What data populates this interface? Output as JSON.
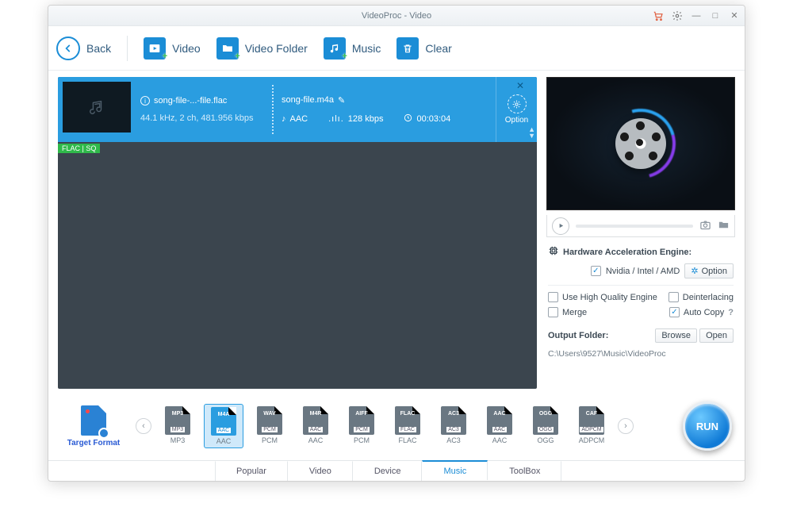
{
  "title": "VideoProc - Video",
  "toolbar": {
    "back": "Back",
    "video": "Video",
    "video_folder": "Video Folder",
    "music": "Music",
    "clear": "Clear"
  },
  "item": {
    "source_name": "song-file-...-file.flac",
    "source_spec": "44.1 kHz, 2 ch, 481.956 kbps",
    "thumb_badge": "FLAC | SQ",
    "output_name": "song-file.m4a",
    "codec": "AAC",
    "bitrate": "128 kbps",
    "duration": "00:03:04",
    "option_label": "Option"
  },
  "side": {
    "hw_title": "Hardware Acceleration Engine:",
    "hw_vendor": "Nvidia / Intel / AMD",
    "hw_option": "Option",
    "hq": "Use High Quality Engine",
    "deint": "Deinterlacing",
    "merge": "Merge",
    "autocopy": "Auto Copy",
    "checks": {
      "hw": true,
      "hq": false,
      "deint": false,
      "merge": false,
      "autocopy": true
    },
    "output_label": "Output Folder:",
    "browse": "Browse",
    "open": "Open",
    "output_path": "C:\\Users\\9527\\Music\\VideoProc"
  },
  "strip": {
    "target_label": "Target Format",
    "formats": [
      {
        "ext": "MP3",
        "ribbon": "MP3",
        "label": "MP3"
      },
      {
        "ext": "M4A",
        "ribbon": "AAC",
        "label": "AAC"
      },
      {
        "ext": "WAV",
        "ribbon": "PCM",
        "label": "PCM"
      },
      {
        "ext": "M4R",
        "ribbon": "AAC",
        "label": "AAC"
      },
      {
        "ext": "AIFF",
        "ribbon": "PCM",
        "label": "PCM"
      },
      {
        "ext": "FLAC",
        "ribbon": "FLAC",
        "label": "FLAC"
      },
      {
        "ext": "AC3",
        "ribbon": "AC3",
        "label": "AC3"
      },
      {
        "ext": "AAC",
        "ribbon": "AAC",
        "label": "AAC"
      },
      {
        "ext": "OGG",
        "ribbon": "OGG",
        "label": "OGG"
      },
      {
        "ext": "CAF",
        "ribbon": "ADPCM",
        "label": "ADPCM"
      }
    ],
    "selected": 1,
    "run": "RUN"
  },
  "cats": {
    "items": [
      "Popular",
      "Video",
      "Device",
      "Music",
      "ToolBox"
    ],
    "selected": 3
  }
}
